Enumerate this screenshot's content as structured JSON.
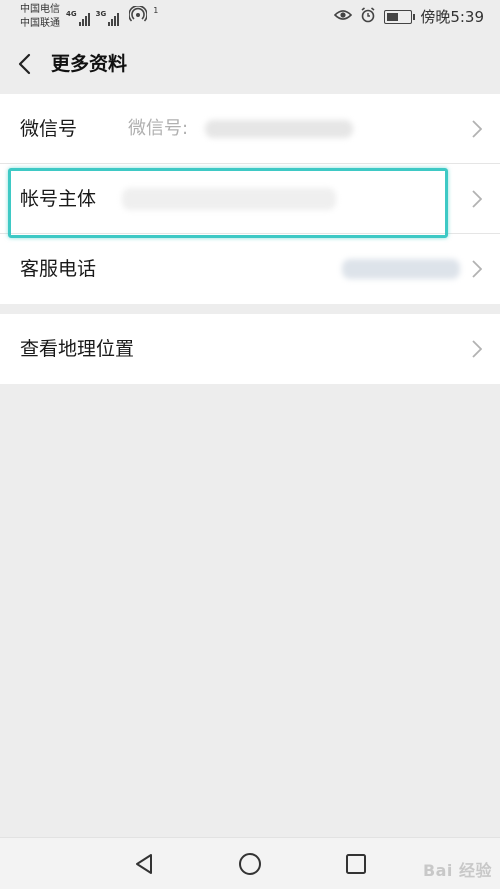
{
  "status_bar": {
    "carrier1": "中国电信",
    "carrier2": "中国联通",
    "signal1_tag": "4G",
    "signal2_tag": "3G",
    "hotspot_label": "1",
    "time": "傍晚5:39"
  },
  "nav": {
    "title": "更多资料"
  },
  "rows": [
    {
      "label": "微信号",
      "value": "微信号:"
    },
    {
      "label": "帐号主体",
      "value": ""
    },
    {
      "label": "客服电话",
      "value": ""
    },
    {
      "label": "查看地理位置",
      "value": ""
    }
  ],
  "watermark": "Bai 经验",
  "colors": {
    "highlight": "#3ec9c5",
    "background": "#ededed"
  }
}
